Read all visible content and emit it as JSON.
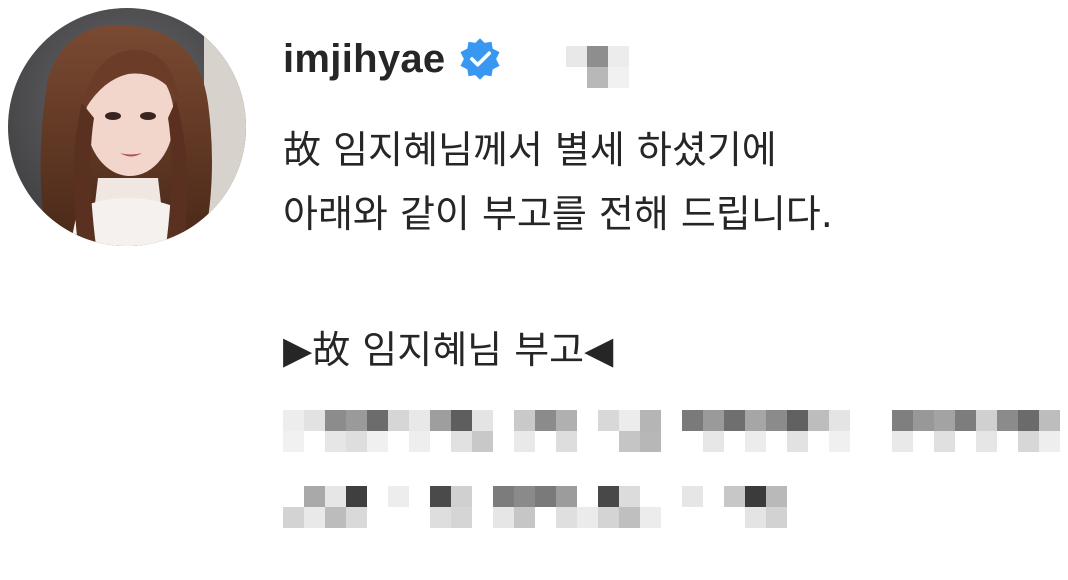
{
  "post": {
    "username": "imjihyae",
    "icons": {
      "verified": "verified-badge-icon",
      "avatar": "profile-photo"
    },
    "caption_lines": [
      "故 임지혜님께서 별세 하셨기에",
      "아래와 같이 부고를 전해 드립니다."
    ],
    "notice_heading": "▶故 임지혜님 부고◀"
  },
  "colors": {
    "verified_blue": "#3897f0",
    "text": "#262626",
    "background": "#ffffff"
  }
}
